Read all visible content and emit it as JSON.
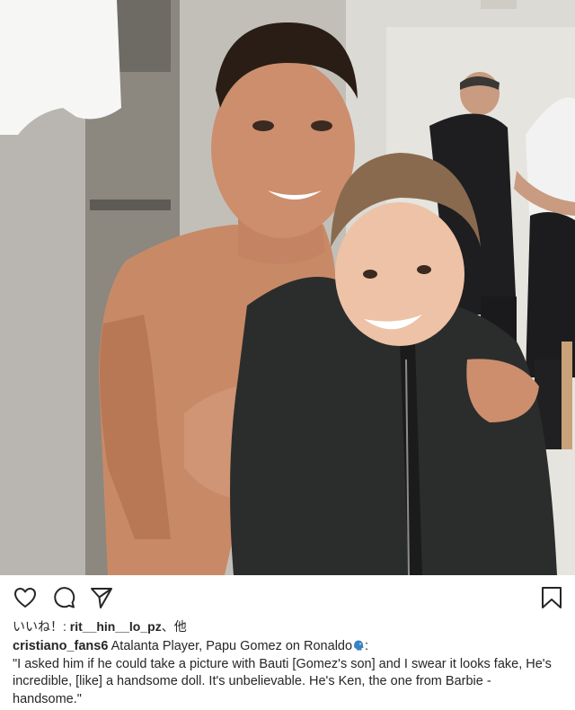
{
  "post": {
    "photo_alt": "",
    "actions": {
      "like_icon": "heart-outline-icon",
      "comment_icon": "comment-bubble-icon",
      "share_icon": "paper-plane-icon",
      "save_icon": "bookmark-icon"
    },
    "likes": {
      "prefix": "いいね！: ",
      "liker": "rit__hin__lo_pz",
      "suffix": "、他"
    },
    "caption": {
      "username": "cristiano_fans6",
      "headline": " Atalanta Player, Papu Gomez on Ronaldo",
      "headline_end": ":",
      "emoji_icon": "speaking-head-icon",
      "quote": "\"I asked him if he could take a picture with Bauti [Gomez's son] and I swear it looks fake, He's incredible, [like] a handsome doll. It's unbelievable. He's Ken, the one from Barbie - handsome.\""
    },
    "colors": {
      "text": "#262626",
      "emoji_blue": "#3b82c4"
    }
  }
}
